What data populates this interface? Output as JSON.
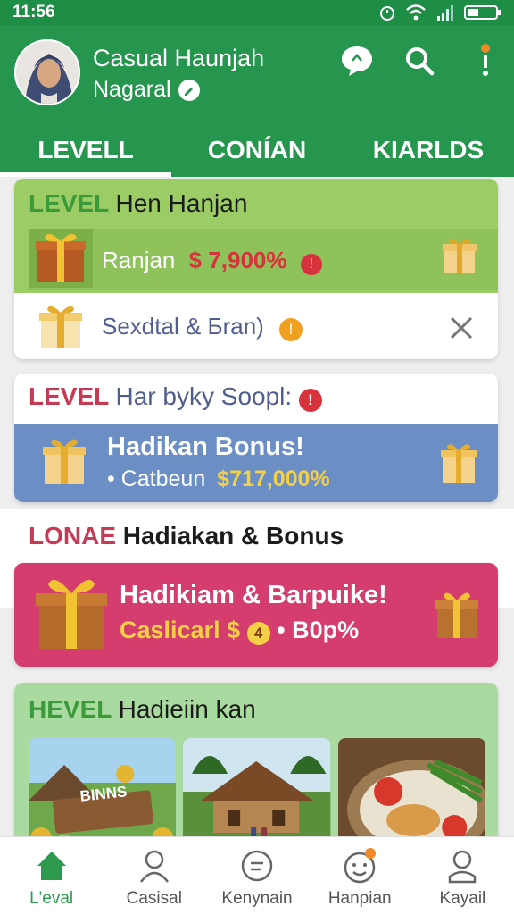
{
  "status_bar": {
    "time": "11:56"
  },
  "header": {
    "user_name": "Casual Haunjah",
    "user_sub": "Nagaral",
    "colors": {
      "header_bg": "#26964f",
      "status_bg": "#1e8e46"
    }
  },
  "tabs": [
    {
      "label": "LEVELL",
      "active": true
    },
    {
      "label": "CONÍAN",
      "active": false
    },
    {
      "label": "KIARLDS",
      "active": false
    }
  ],
  "card1": {
    "level_word": "LEVEL",
    "title": "Hen Hanjan",
    "row_label": "Ranjan",
    "row_amount": "$ 7,900%",
    "bottom_label": "Sexdtal & Бran)"
  },
  "card2": {
    "level_word": "LEVEL",
    "title": "Har byky Soopl:",
    "bonus_title": "Hadikan Bonus!",
    "bonus_label": "• Catbeun",
    "bonus_amount": "$717,000%"
  },
  "section": {
    "level_word": "LONAE",
    "title": "Hadiakan & Bonus"
  },
  "card3": {
    "title": "Hadikiam & Barpuike!",
    "sub_label": "Caslicarl $",
    "sub_badge": "4",
    "sub_value": "• B0p%"
  },
  "card4": {
    "level_word": "HEVEL",
    "title": "Hadieiin kan",
    "bonus_sign": "BINNS"
  },
  "nav": [
    {
      "label": "L'eval",
      "icon": "home-icon",
      "active": true
    },
    {
      "label": "Casisal",
      "icon": "person-icon",
      "active": false
    },
    {
      "label": "Kenynain",
      "icon": "chat-icon",
      "active": false
    },
    {
      "label": "Hanpian",
      "icon": "face-icon",
      "active": false
    },
    {
      "label": "Kayail",
      "icon": "user-icon",
      "active": false
    }
  ]
}
